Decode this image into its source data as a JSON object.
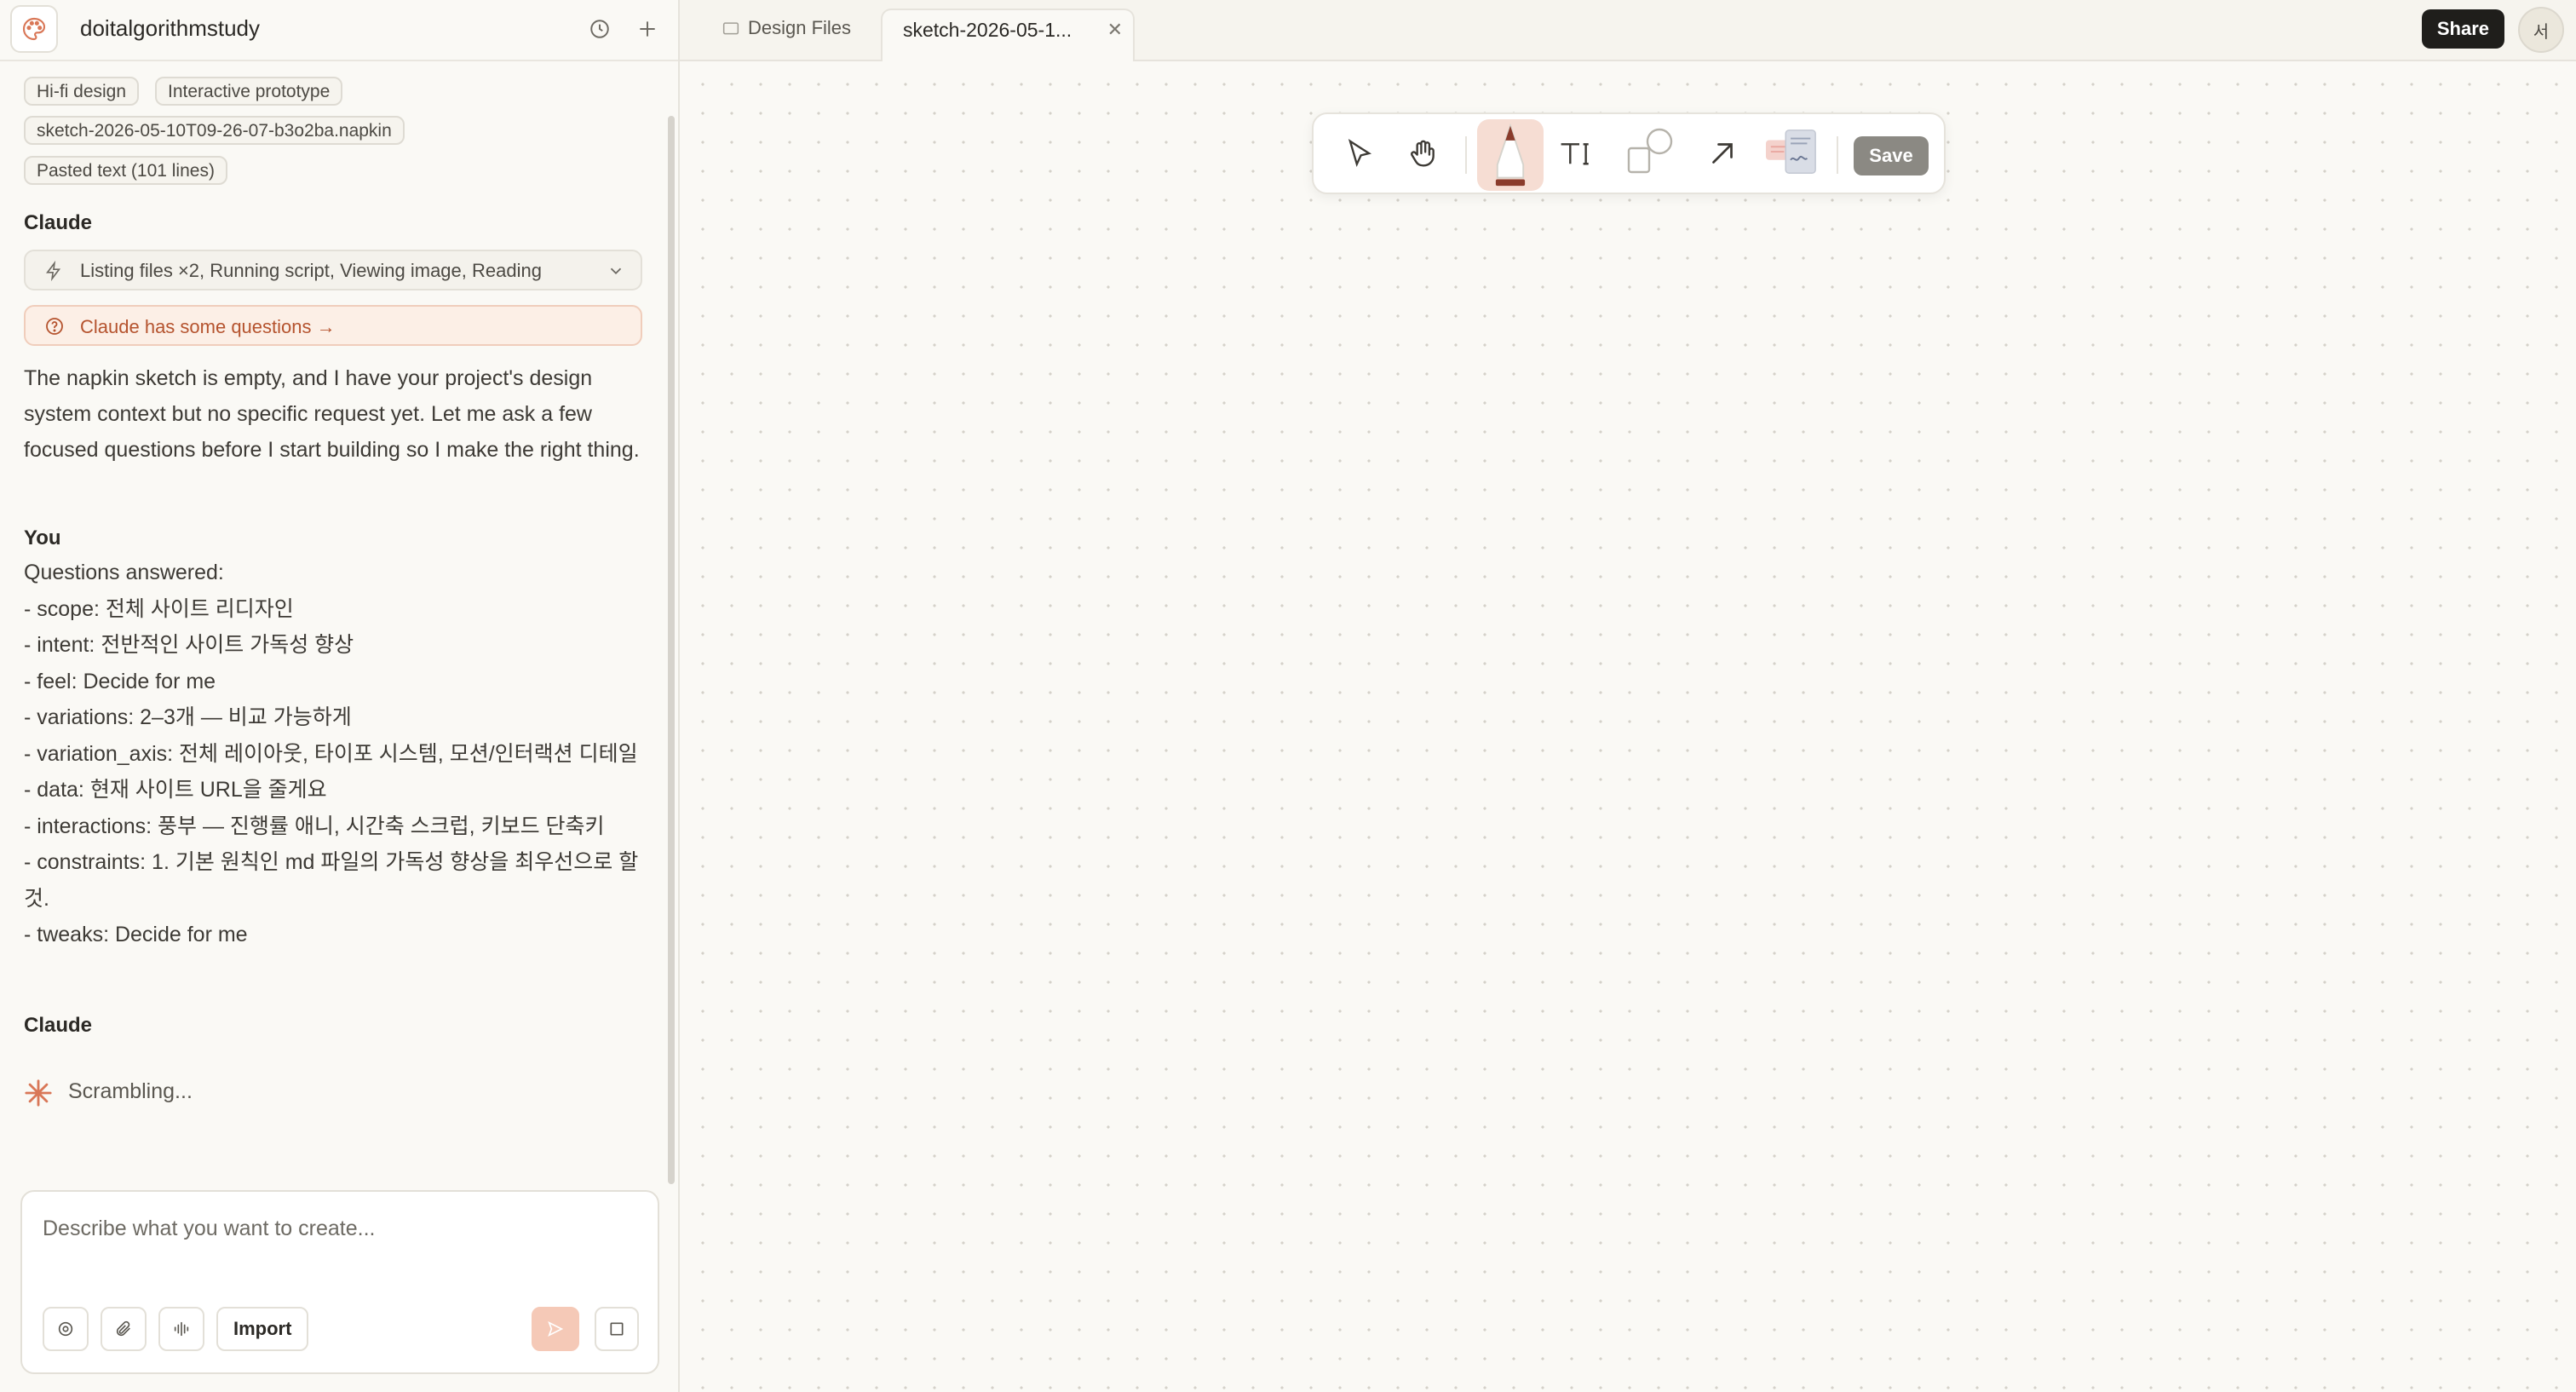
{
  "sidebar": {
    "project_name": "doitalgorithmstudy",
    "chips": [
      "Hi-fi design",
      "Interactive prototype",
      "sketch-2026-05-10T09-26-07-b3o2ba.napkin",
      "Pasted text (101 lines)"
    ],
    "messages": {
      "claude_label": "Claude",
      "activity": "Listing files ×2, Running script, Viewing image, Reading",
      "questions_link": "Claude has some questions →",
      "claude_text": "The napkin sketch is empty, and I have your project's design system context but no specific request yet. Let me ask a few focused questions before I start building so I make the right thing.",
      "you_label": "You",
      "you_lines": [
        "Questions answered:",
        "- scope: 전체 사이트 리디자인",
        "- intent: 전반적인 사이트 가독성 향상",
        "- feel: Decide for me",
        "- variations: 2–3개 — 비교 가능하게",
        "- variation_axis: 전체 레이아웃, 타이포 시스템, 모션/인터랙션 디테일",
        "- data: 현재 사이트 URL을 줄게요",
        "- interactions: 풍부 — 진행률 애니, 시간축 스크럽, 키보드 단축키",
        "- constraints: 1. 기본 원칙인 md 파일의 가독성 향상을 최우선으로 할 것.",
        "- tweaks: Decide for me"
      ],
      "claude_label_2": "Claude",
      "status": "Scrambling..."
    },
    "composer": {
      "placeholder": "Describe what you want to create...",
      "import_label": "Import"
    }
  },
  "tabs": [
    {
      "label": "Design Files"
    },
    {
      "label": "sketch-2026-05-1..."
    }
  ],
  "topbar": {
    "share_label": "Share",
    "avatar_initial": "서"
  },
  "toolbar": {
    "save_label": "Save"
  },
  "colors": {
    "accent": "#d97757",
    "primary_dark": "#1f1e1b",
    "canvas_bg": "#faf9f5"
  }
}
